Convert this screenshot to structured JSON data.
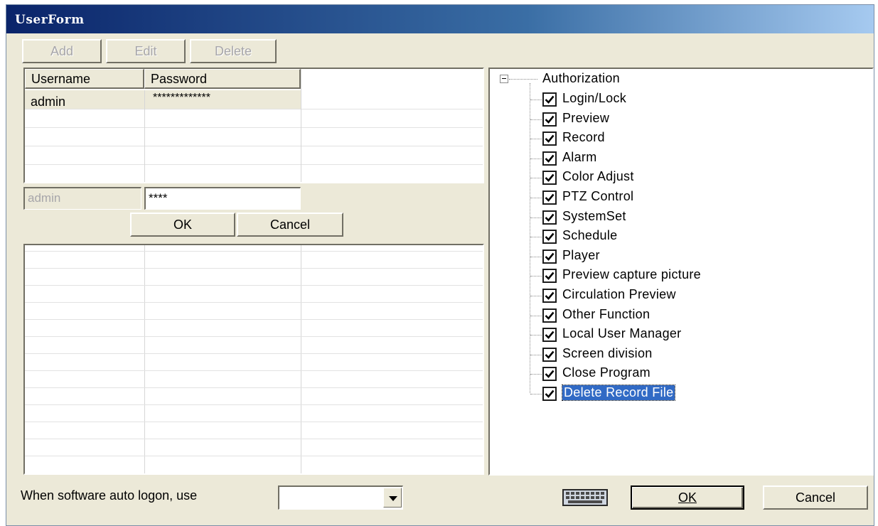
{
  "window": {
    "title": "UserForm"
  },
  "toolbar": {
    "add_label": "Add",
    "edit_label": "Edit",
    "delete_label": "Delete"
  },
  "users_table": {
    "columns": [
      "Username",
      "Password"
    ],
    "rows": [
      {
        "username": "admin",
        "password": "*************"
      }
    ]
  },
  "edit_row": {
    "username_value": "admin",
    "password_value": "****",
    "ok_label": "OK",
    "cancel_label": "Cancel"
  },
  "authorization_tree": {
    "root_label": "Authorization",
    "expander": "minus",
    "items": [
      {
        "label": "Login/Lock",
        "checked": true
      },
      {
        "label": "Preview",
        "checked": true
      },
      {
        "label": "Record",
        "checked": true
      },
      {
        "label": "Alarm",
        "checked": true
      },
      {
        "label": "Color Adjust",
        "checked": true
      },
      {
        "label": "PTZ Control",
        "checked": true
      },
      {
        "label": "SystemSet",
        "checked": true
      },
      {
        "label": "Schedule",
        "checked": true
      },
      {
        "label": "Player",
        "checked": true
      },
      {
        "label": "Preview capture picture",
        "checked": true
      },
      {
        "label": "Circulation Preview",
        "checked": true
      },
      {
        "label": "Other Function",
        "checked": true
      },
      {
        "label": "Local User Manager",
        "checked": true
      },
      {
        "label": "Screen division",
        "checked": true
      },
      {
        "label": "Close Program",
        "checked": true
      },
      {
        "label": "Delete Record File",
        "checked": true,
        "selected": true
      }
    ]
  },
  "footer": {
    "autologon_label": "When software auto logon, use",
    "autologon_value": "",
    "keyboard_icon": "keyboard-icon",
    "ok_label": "OK",
    "cancel_label": "Cancel"
  },
  "colors": {
    "titlebar_start": "#0a246a",
    "titlebar_end": "#a6caf0",
    "window_bg": "#ece9d8",
    "selection": "#316ac5"
  }
}
